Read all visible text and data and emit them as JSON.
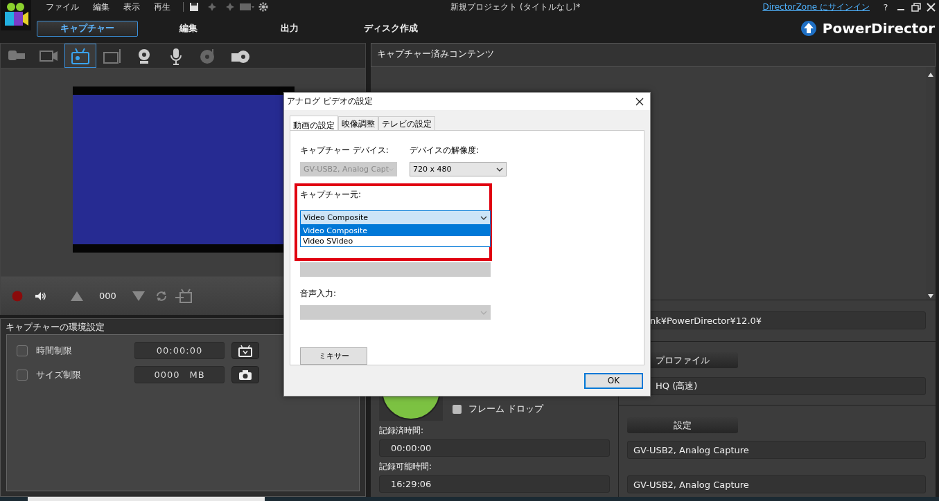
{
  "menu": [
    "ファイル",
    "編集",
    "表示",
    "再生"
  ],
  "window": {
    "title": "新規プロジェクト (タイトルなし)*",
    "signin_link": "DirectorZone にサインイン",
    "help": "?"
  },
  "modes": [
    {
      "label": "キャプチャー",
      "selected": true
    },
    {
      "label": "編集",
      "selected": false
    },
    {
      "label": "出力",
      "selected": false
    },
    {
      "label": "ディスク作成",
      "selected": false
    }
  ],
  "brand": "PowerDirector",
  "capture_sources": [
    {
      "kind": "camcorder",
      "selected": false
    },
    {
      "kind": "hdv",
      "selected": false
    },
    {
      "kind": "tv",
      "selected": true
    },
    {
      "kind": "digital-tv",
      "selected": false
    },
    {
      "kind": "webcam",
      "selected": false
    },
    {
      "kind": "mic",
      "selected": false
    },
    {
      "kind": "cd",
      "selected": false
    },
    {
      "kind": "dvd",
      "selected": false
    }
  ],
  "controls": {
    "counter": "000"
  },
  "capture_settings": {
    "title": "キャプチャーの環境設定",
    "rows": [
      {
        "kind": "time",
        "label": "時間制限",
        "checked": false,
        "value": "00:00:00"
      },
      {
        "kind": "size",
        "label": "サイズ制限",
        "checked": false,
        "value": "0000",
        "unit": "MB"
      }
    ]
  },
  "captured_content": {
    "title": "キャプチャー済みコンテンツ"
  },
  "status": {
    "frame_drop": {
      "label": "フレーム ドロップ",
      "checked": false
    },
    "recorded_label": "記録済時間:",
    "recorded": "00:00:00",
    "remaining_label": "記録可能時間:",
    "remaining": "16:29:06"
  },
  "output": {
    "path": "nk¥PowerDirector¥12.0¥",
    "profile_button": "プロファイル",
    "profile": "HQ (高速)",
    "settings_button": "設定",
    "video_device": "GV-USB2, Analog Capture",
    "audio_device": "GV-USB2, Analog Capture"
  },
  "dialog": {
    "title": "アナログ ビデオの設定",
    "tabs": [
      {
        "label": "動画の設定",
        "selected": true
      },
      {
        "label": "映像調整",
        "selected": false
      },
      {
        "label": "テレビの設定",
        "selected": false
      }
    ],
    "fields": [
      {
        "label": "キャプチャー デバイス:",
        "value": "GV-USB2, Analog Capt",
        "disabled": true
      },
      {
        "label": "デバイスの解像度:",
        "value": "720 x 480",
        "disabled": false
      },
      {
        "label": "キャプチャー元:",
        "value": "Video Composite",
        "disabled": false,
        "options": [
          {
            "label": "Video Composite",
            "selected": true
          },
          {
            "label": "Video SVideo",
            "selected": false
          }
        ]
      },
      {
        "label": "音声入力:",
        "disabled": true
      }
    ],
    "mixer_button": "ミキサー",
    "ok_button": "OK"
  }
}
